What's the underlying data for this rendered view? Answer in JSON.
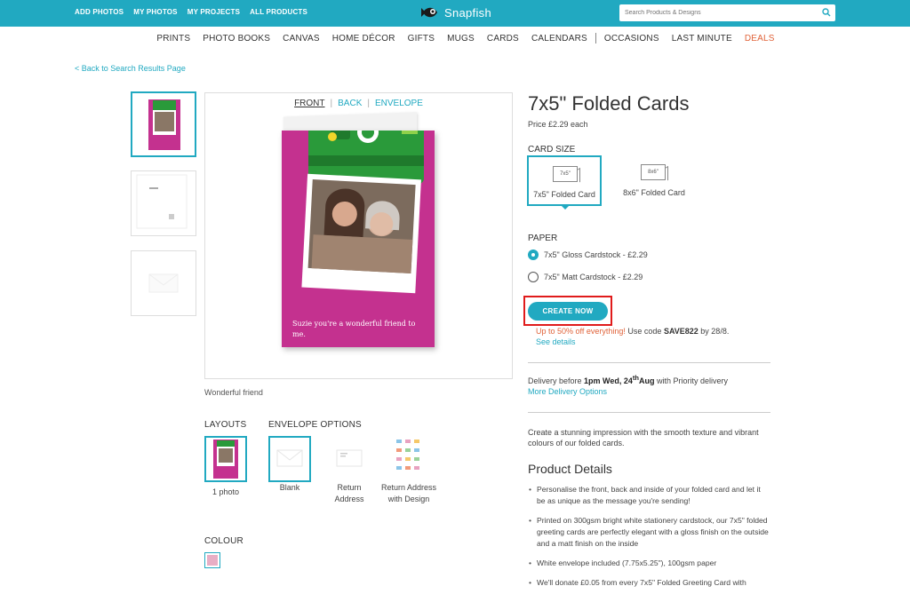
{
  "topnav": {
    "links": [
      "ADD PHOTOS",
      "MY PHOTOS",
      "MY PROJECTS",
      "ALL PRODUCTS"
    ],
    "logo": "Snapfish",
    "search_placeholder": "Search Products & Designs"
  },
  "categories": [
    "PRINTS",
    "PHOTO BOOKS",
    "CANVAS",
    "HOME DÉCOR",
    "GIFTS",
    "MUGS",
    "CARDS",
    "CALENDARS",
    "OCCASIONS",
    "LAST MINUTE",
    "DEALS"
  ],
  "back_link": "< Back to Search Results Page",
  "preview": {
    "tabs": [
      "FRONT",
      "BACK",
      "ENVELOPE"
    ],
    "card_message": "Suzie you're a wonderful friend to me.",
    "caption": "Wonderful friend"
  },
  "layouts": {
    "label": "LAYOUTS",
    "items": [
      "1 photo"
    ]
  },
  "envelope": {
    "label": "ENVELOPE OPTIONS",
    "items": [
      "Blank",
      "Return Address",
      "Return Address with Design"
    ]
  },
  "colour": {
    "label": "COLOUR",
    "swatch": "#e8aec5"
  },
  "product": {
    "title": "7x5\" Folded Cards",
    "price": "Price £2.29 each",
    "card_size_label": "CARD SIZE",
    "sizes": [
      {
        "icon": "7x5\"",
        "label": "7x5\" Folded Card",
        "selected": true
      },
      {
        "icon": "8x6\"",
        "label": "8x6\" Folded Card",
        "selected": false
      }
    ],
    "paper_label": "PAPER",
    "papers": [
      {
        "label": "7x5\" Gloss Cardstock - £2.29",
        "selected": true
      },
      {
        "label": "7x5\" Matt Cardstock - £2.29",
        "selected": false
      }
    ],
    "create_button": "CREATE NOW",
    "promo_hot": "Up to 50% off everything!",
    "promo_mid": " Use code ",
    "promo_code": "SAVE822",
    "promo_end": " by 28/8.",
    "see_details": "See details",
    "delivery_pre": "Delivery before ",
    "delivery_date": "1pm Wed, 24",
    "delivery_sup": "th",
    "delivery_month": "Aug",
    "delivery_post": " with Priority delivery",
    "more_delivery": "More Delivery Options",
    "description": "Create a stunning impression with the smooth texture and vibrant colours of our folded cards.",
    "details_heading": "Product Details",
    "details": [
      "Personalise the front, back and inside of your folded card and let it be as unique as the message you're sending!",
      "Printed on 300gsm bright white stationery cardstock, our 7x5\" folded greeting cards are perfectly elegant with a gloss finish on the outside and a matt finish on the inside",
      "White envelope included (7.75x5.25\"), 100gsm paper",
      "We'll donate £0.05 from every 7x5\" Folded Greeting Card with"
    ]
  },
  "colors": {
    "accent": "#21a9c1",
    "deals": "#e0633a",
    "card": "#c4318f",
    "highlight": "#e01b1b"
  }
}
